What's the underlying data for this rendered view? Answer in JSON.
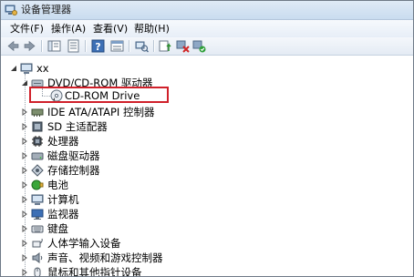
{
  "window": {
    "title": "设备管理器"
  },
  "menu": [
    {
      "label": "文件(F)"
    },
    {
      "label": "操作(A)"
    },
    {
      "label": "查看(V)"
    },
    {
      "label": "帮助(H)"
    }
  ],
  "tree": {
    "root": {
      "label": "xx"
    },
    "dvd_category": {
      "label": "DVD/CD-ROM 驱动器"
    },
    "cdrom_device": {
      "label": "CD-ROM Drive"
    },
    "categories": [
      {
        "label": "IDE ATA/ATAPI 控制器",
        "icon": "ide-controller-icon"
      },
      {
        "label": "SD 主适配器",
        "icon": "sd-host-icon"
      },
      {
        "label": "处理器",
        "icon": "processor-icon"
      },
      {
        "label": "磁盘驱动器",
        "icon": "disk-drive-icon"
      },
      {
        "label": "存储控制器",
        "icon": "storage-controller-icon"
      },
      {
        "label": "电池",
        "icon": "battery-icon"
      },
      {
        "label": "计算机",
        "icon": "computer-icon"
      },
      {
        "label": "监视器",
        "icon": "monitor-icon"
      },
      {
        "label": "键盘",
        "icon": "keyboard-icon"
      },
      {
        "label": "人体学输入设备",
        "icon": "hid-icon"
      },
      {
        "label": "声音、视频和游戏控制器",
        "icon": "sound-icon"
      },
      {
        "label": "鼠标和其他指针设备",
        "icon": "mouse-icon"
      }
    ]
  },
  "colors": {
    "highlight_border": "#d0202a",
    "tree_line": "#9aa3ad"
  }
}
